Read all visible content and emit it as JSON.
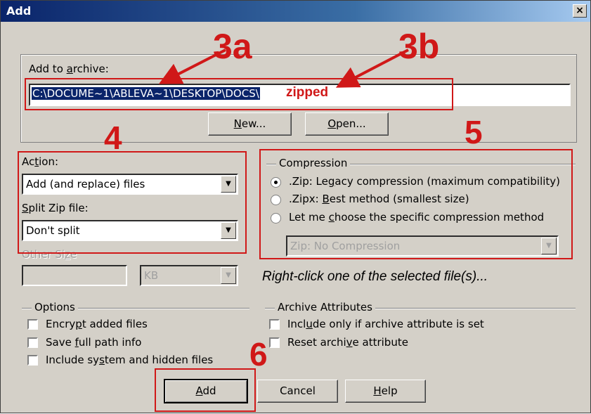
{
  "window": {
    "title": "Add",
    "close_label": "×"
  },
  "archive": {
    "label_prefix": "Add to ",
    "label_ul": "a",
    "label_suffix": "rchive:",
    "path_selected": "C:\\DOCUME~1\\ABLEVA~1\\DESKTOP\\DOCS\\",
    "path_typed": "zipped",
    "new_ul": "N",
    "new_rest": "ew...",
    "open_ul": "O",
    "open_rest": "pen..."
  },
  "action": {
    "label_pre": "Ac",
    "label_ul": "t",
    "label_post": "ion:",
    "value": "Add (and replace) files"
  },
  "split": {
    "label_ul": "S",
    "label_post": "plit Zip file:",
    "value": "Don't split"
  },
  "other_size": {
    "label_pre": "Other Si",
    "label_ul": "z",
    "label_post": "e",
    "unit": "KB"
  },
  "compression": {
    "legend": "Compression",
    "options": [
      {
        "pre": ".Zip: Le",
        "ul": "g",
        "post": "acy compression (maximum compatibility)",
        "selected": true
      },
      {
        "pre": ".Zipx: ",
        "ul": "B",
        "post": "est method (smallest size)",
        "selected": false
      },
      {
        "pre": "Let me ",
        "ul": "c",
        "post": "hoose the specific compression method",
        "selected": false
      }
    ],
    "method_value": "Zip: No Compression"
  },
  "hint": "Right-click one of the selected file(s)...",
  "options": {
    "legend": "Options",
    "items": [
      {
        "pre": "Encry",
        "ul": "p",
        "post": "t added files"
      },
      {
        "pre": "Save ",
        "ul": "f",
        "post": "ull path info"
      },
      {
        "pre": "Include sy",
        "ul": "s",
        "post": "tem and hidden files"
      }
    ]
  },
  "attributes": {
    "legend": "Archive Attributes",
    "items": [
      {
        "pre": "Incl",
        "ul": "u",
        "post": "de only if archive attribute is set"
      },
      {
        "pre": "Reset archi",
        "ul": "v",
        "post": "e attribute"
      }
    ]
  },
  "buttons": {
    "add_ul": "A",
    "add_rest": "dd",
    "cancel": "Cancel",
    "help_ul": "H",
    "help_rest": "elp"
  },
  "annotations": {
    "n3a": "3a",
    "n3b": "3b",
    "n4": "4",
    "n5": "5",
    "n6": "6",
    "red": "#d01818"
  }
}
